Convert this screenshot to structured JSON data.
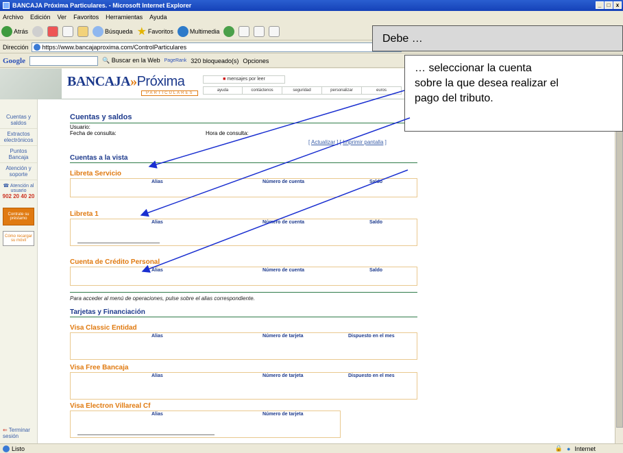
{
  "window": {
    "title": "BANCAJA Próxima Particulares. - Microsoft Internet Explorer"
  },
  "menu": [
    "Archivo",
    "Edición",
    "Ver",
    "Favoritos",
    "Herramientas",
    "Ayuda"
  ],
  "toolbar": {
    "back": "Atrás",
    "search": "Búsqueda",
    "favorites": "Favoritos",
    "media": "Multimedia"
  },
  "address": {
    "label": "Dirección",
    "url": "https://www.bancajaproxima.com/ControlParticulares"
  },
  "google": {
    "logo": "Google",
    "search_web": "Buscar en la Web",
    "pagerank": "PageRank",
    "blocked": "320 bloqueado(s)",
    "options": "Opciones"
  },
  "banner": {
    "brand": "BANCAJA",
    "arrows": "»",
    "brand2": "Próxima",
    "brand_sub": "PARTICULARES",
    "messages": "mensajes por leer",
    "tabs": [
      "ayuda",
      "contáctenos",
      "seguridad",
      "personalizar",
      "euros"
    ]
  },
  "sidebar": {
    "items": [
      "Cuentas y saldos",
      "Extractos electrónicos",
      "Puntos Bancaja",
      "Atención y soporte"
    ],
    "support_label": "Atención al usuario",
    "phone": "902 20 40 20",
    "orange_box": "Contrate su préstamo",
    "mobile_box": "Cómo recargar su móvil",
    "logout": "Terminar sesión"
  },
  "content": {
    "title": "Cuentas y saldos",
    "user_label": "Usuario:",
    "date_label": "Fecha de consulta:",
    "time_label": "Hora de consulta:",
    "refresh": "Actualizar",
    "print": "Imprimir pantalla",
    "section1": "Cuentas a la vista",
    "accounts": [
      {
        "name": "Libreta Servicio",
        "h1": "Alias",
        "h2": "Número de cuenta",
        "h3": "Saldo"
      },
      {
        "name": "Libreta 1",
        "h1": "Alias",
        "h2": "Número de cuenta",
        "h3": "Saldo"
      },
      {
        "name": "Cuenta de Crédito Personal",
        "h1": "Alias",
        "h2": "Número de cuenta",
        "h3": "Saldo"
      }
    ],
    "note": "Para acceder al menú de operaciones, pulse sobre el alias correspondiente.",
    "section2": "Tarjetas y Financiación",
    "cards": [
      {
        "name": "Visa Classic Entidad",
        "h1": "Alias",
        "h2": "Número de tarjeta",
        "h3": "Dispuesto en el mes"
      },
      {
        "name": "Visa Free Bancaja",
        "h1": "Alias",
        "h2": "Número de tarjeta",
        "h3": "Dispuesto en el mes"
      },
      {
        "name": "Visa Electron Villareal Cf",
        "h1": "Alias",
        "h2": "Número de tarjeta",
        "h3": ""
      }
    ]
  },
  "status": {
    "left": "Listo",
    "zone": "Internet"
  },
  "callouts": {
    "top": "Debe …",
    "main_lines": [
      "… seleccionar la cuenta",
      "sobre la que desea realizar el",
      "pago del tributo."
    ]
  }
}
